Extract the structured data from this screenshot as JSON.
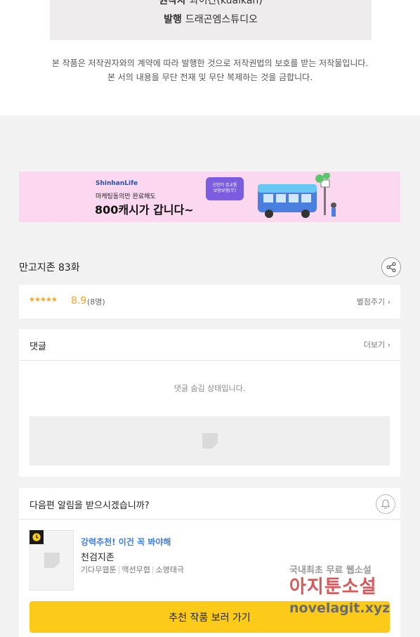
{
  "credits": {
    "line1_key": "원작자",
    "line1_value": "콰이칸(kuaikan)",
    "line2_key": "발행",
    "line2_value": "드래곤엠스튜디오"
  },
  "copyright": {
    "line1": "본 작품은 저작권자와의 계약에 따라 발행한 것으로 저작권법의 보호를 받는 저작물입니다.",
    "line2": "본 서의 내용을 무단 전재 및 무단 복제하는 것을 금합니다."
  },
  "banner": {
    "brand": "ShinhanLife",
    "sub": "마케팅동의만 완료해도",
    "main": "800캐시가 갑니다~",
    "badge": "신한더 쥬교통\n보장보험(무)"
  },
  "episode": {
    "title": "만고지존 83화"
  },
  "rating": {
    "stars": "★★★★★",
    "score": "8.9",
    "count": "(8명)",
    "rate_link": "별점주기 ›"
  },
  "comments": {
    "title": "댓글",
    "more_link": "더보기 ›",
    "hidden_text": "댓글 숨김 상태입니다."
  },
  "notify": {
    "question": "다음편 알림을 받으시겠습니까?"
  },
  "recommend": {
    "tag": "강력추천! 이건 꼭 봐야해",
    "title": "천검지존",
    "genres": [
      "기다무웹툰",
      "액션무협",
      "소명태극"
    ],
    "button": "추천 작품 보러 가기"
  },
  "watermark": {
    "line1": "국내최초 무료 웹소설",
    "line2": "아지툰소설",
    "line3": "novelagit.xyz"
  },
  "colors": {
    "accent_yellow": "#fccb1a",
    "star_orange": "#f5a623",
    "tag_blue": "#3d7fe0",
    "banner_pink": "#fbd8f0"
  }
}
